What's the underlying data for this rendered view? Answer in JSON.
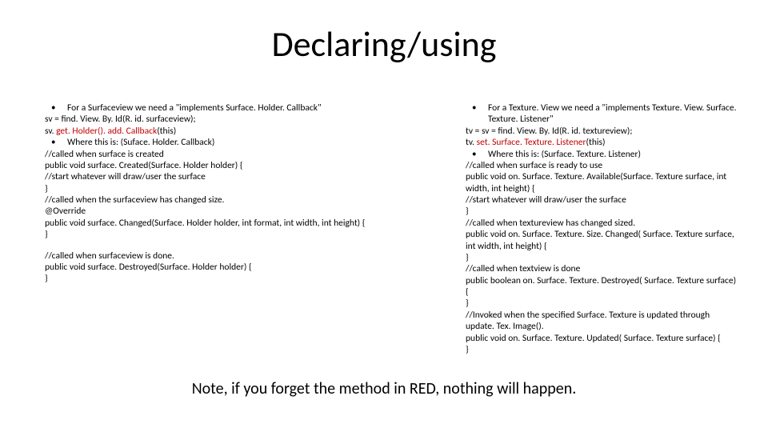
{
  "title": "Declaring/using",
  "left": {
    "bullet1": "For a Surfaceview  we need a \"implements Surface. Holder. Callback\"",
    "l1": "sv = find. View. By. Id(R. id. surfaceview);",
    "l2a": "sv. ",
    "l2b": "get. Holder(). add. Callback",
    "l2c": "(this)",
    "bullet2": "Where this is:  (Suface. Holder. Callback)",
    "l3": "//called when surface is created",
    "l4": "public void surface. Created(Surface. Holder holder) {",
    "l5": "  //start whatever will draw/user the surface",
    "l6": "}",
    "l7": "//called when the surfaceview has changed size.",
    "l8": "@Override",
    "l9": "public void surface. Changed(Surface. Holder holder, int format, int width, int height) {",
    "l10": "}",
    "l11": "//called when surfaceview is done.",
    "l12": "public void surface. Destroyed(Surface. Holder holder) {",
    "l13": "}"
  },
  "right": {
    "bullet1": "For a Texture. View we need a \"implements Texture. View. Surface. Texture. Listener\"",
    "r1": "tv = sv = find. View. By. Id(R. id. textureview);",
    "r2a": "tv. ",
    "r2b": "set. Surface. Texture. Listener",
    "r2c": "(this)",
    "bullet2": "Where this is: (Surface. Texture. Listener)",
    "r3": "//called when surface is ready to use",
    "r4": "public void on. Surface. Texture. Available(Surface. Texture surface, int width, int height) {",
    "r5": "  //start whatever will draw/user the surface",
    "r6": "}",
    "r7": "//called when textureview has changed sized.",
    "r8": " public void on. Surface. Texture. Size. Changed( Surface. Texture surface, int width, int height) {",
    "r9": "}",
    "r10": "//called when textview is done",
    "r11": "public boolean on. Surface. Texture. Destroyed( Surface. Texture surface) {",
    "r12": "}",
    "r13": "//Invoked when the specified Surface. Texture is updated through update. Tex. Image().",
    "r14": " public void on. Surface. Texture. Updated( Surface. Texture surface) {",
    "r15": "}"
  },
  "note": "Note, if you forget the method in RED, nothing will happen."
}
